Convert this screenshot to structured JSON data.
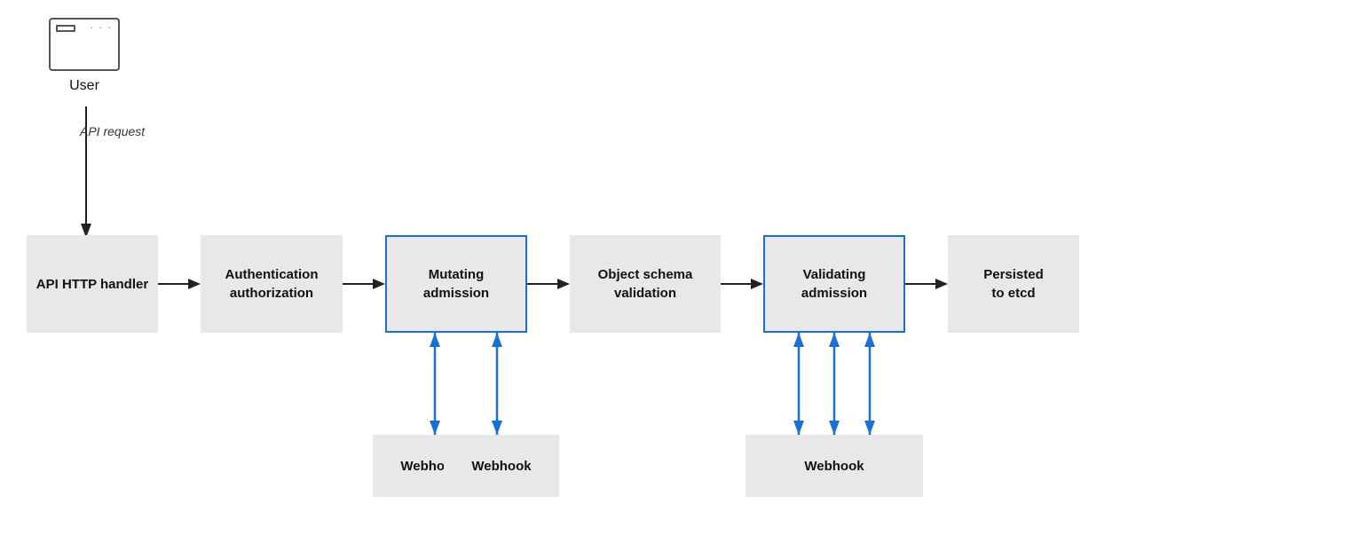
{
  "diagram": {
    "user_label": "User",
    "api_request_label": "API request",
    "boxes": [
      {
        "id": "api-http",
        "label": "API HTTP\nhandler",
        "blue_border": false
      },
      {
        "id": "auth",
        "label": "Authentication\nauthorization",
        "blue_border": false
      },
      {
        "id": "mutating",
        "label": "Mutating\nadmission",
        "blue_border": true
      },
      {
        "id": "schema",
        "label": "Object schema\nvalidation",
        "blue_border": false
      },
      {
        "id": "validating",
        "label": "Validating\nadmission",
        "blue_border": true
      },
      {
        "id": "etcd",
        "label": "Persisted\nto etcd",
        "blue_border": false
      }
    ],
    "webhooks": [
      {
        "id": "webhook1",
        "label": "Webhook"
      },
      {
        "id": "webhook2",
        "label": "Webhook"
      },
      {
        "id": "webhook3",
        "label": "Webhook"
      }
    ],
    "colors": {
      "blue": "#1a6fd4",
      "arrow_dark": "#222",
      "box_bg": "#e8e8e8"
    }
  }
}
